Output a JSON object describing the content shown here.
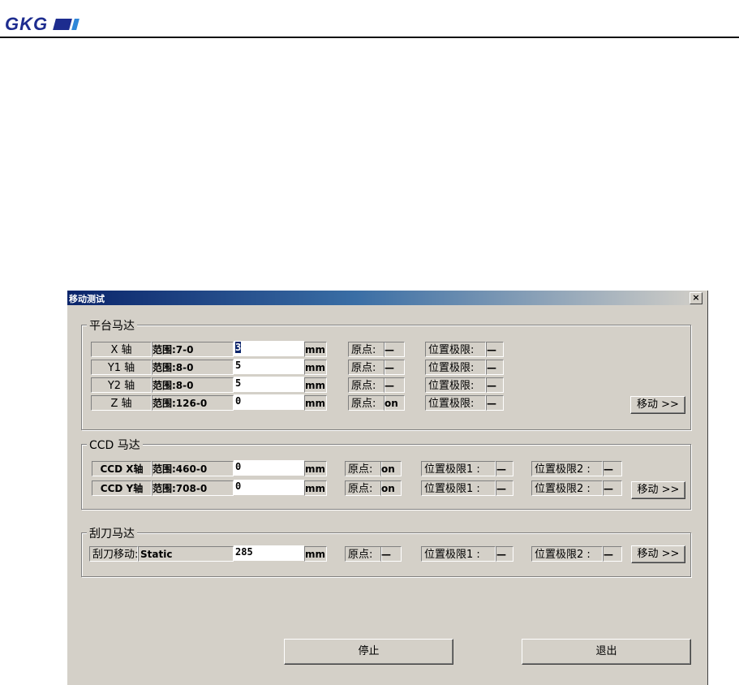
{
  "brand": {
    "logo_text": "GKG"
  },
  "dialog": {
    "title": "移动测试",
    "close": "×"
  },
  "platform": {
    "legend": "平台马达",
    "unit": "mm",
    "origin_label": "原点:",
    "limit_label": "位置极限:",
    "rows": [
      {
        "axis": "X 轴",
        "range": "范围:7-0",
        "value": "3",
        "origin": "—",
        "limit": "—"
      },
      {
        "axis": "Y1 轴",
        "range": "范围:8-0",
        "value": "5",
        "origin": "—",
        "limit": "—"
      },
      {
        "axis": "Y2 轴",
        "range": "范围:8-0",
        "value": "5",
        "origin": "—",
        "limit": "—"
      },
      {
        "axis": "Z 轴",
        "range": "范围:126-0",
        "value": "0",
        "origin": "on",
        "limit": "—"
      }
    ],
    "move_button": "移动 >>"
  },
  "ccd": {
    "legend": "CCD 马达",
    "unit": "mm",
    "origin_label": "原点:",
    "limit1_label": "位置极限1 :",
    "limit2_label": "位置极限2 :",
    "rows": [
      {
        "axis": "CCD X轴",
        "range": "范围:460-0",
        "value": "0",
        "origin": "on",
        "limit1": "—",
        "limit2": "—"
      },
      {
        "axis": "CCD Y轴",
        "range": "范围:708-0",
        "value": "0",
        "origin": "on",
        "limit1": "—",
        "limit2": "—"
      }
    ],
    "move_button": "移动 >>"
  },
  "squeegee": {
    "legend": "刮刀马达",
    "label": "刮刀移动:",
    "mode": "Static",
    "value": "285",
    "unit": "mm",
    "origin_label": "原点:",
    "origin": "—",
    "limit1_label": "位置极限1 :",
    "limit1": "—",
    "limit2_label": "位置极限2 :",
    "limit2": "—",
    "move_button": "移动 >>"
  },
  "footer": {
    "stop_button": "停止",
    "exit_button": "退出"
  }
}
